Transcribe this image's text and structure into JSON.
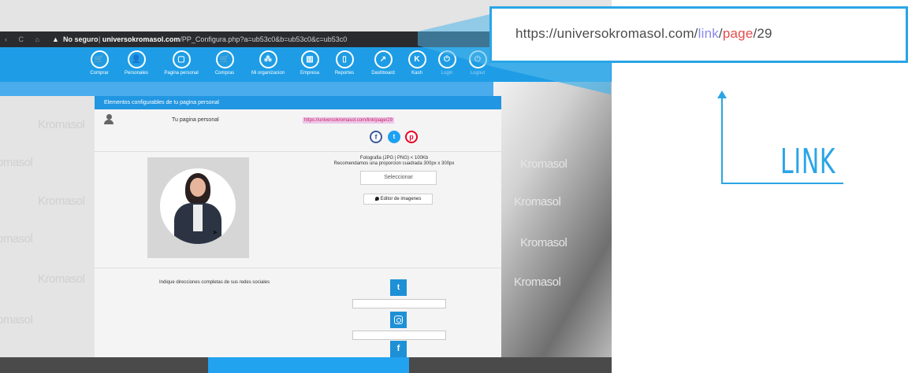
{
  "browser": {
    "security_label": "No seguro",
    "url_domain": "universokromasol.com",
    "url_path": "/PP_Configura.php?a=ub53c0&b=ub53c0&c=ub53c0"
  },
  "nav": {
    "items": [
      {
        "label": "Comprar",
        "icon": "cart-icon",
        "glyph": "🛒"
      },
      {
        "label": "Personales",
        "icon": "person-icon",
        "glyph": "👤"
      },
      {
        "label": "Pagina personal",
        "icon": "page-icon",
        "glyph": "▢"
      },
      {
        "label": "Compras",
        "icon": "cart-icon",
        "glyph": "🛒"
      },
      {
        "label": "Mi organizacion",
        "icon": "org-icon",
        "glyph": "⁂"
      },
      {
        "label": "Empresa",
        "icon": "building-icon",
        "glyph": "▥"
      },
      {
        "label": "Reportes",
        "icon": "report-icon",
        "glyph": "▯"
      },
      {
        "label": "Dashboard",
        "icon": "chart-icon",
        "glyph": "↗"
      },
      {
        "label": "Kash",
        "icon": "kash-icon",
        "glyph": "K"
      },
      {
        "label": "Login",
        "icon": "power-icon",
        "glyph": "⏻"
      },
      {
        "label": "Logout",
        "icon": "power-icon",
        "glyph": "⏻"
      }
    ]
  },
  "watermark": "Kromasol",
  "panel": {
    "header": "Elementos configurables de tu pagina personal",
    "your_page_label": "Tu pagina personal",
    "personal_link": "https://universokromasol.com/link/page/29",
    "upload_line1": "Fotografia (JPG | PNG) < 100Kb",
    "upload_line2": "Recomendamos una proporcion cuadrada 300px x 300px",
    "select_button": "Seleccionar",
    "editor_button": "Editor de imagenes",
    "social_label": "Indique direcciones completas de sus redes sociales"
  },
  "callout": {
    "url_base": "https://universokromasol.com/",
    "url_link": "link",
    "url_slash": "/",
    "url_page": "page",
    "url_tail": "/29",
    "caption": "LINK"
  },
  "colors": {
    "accent": "#1e9de6",
    "callout_border": "#2aa5e6",
    "link_highlight": "#cc1f63"
  }
}
